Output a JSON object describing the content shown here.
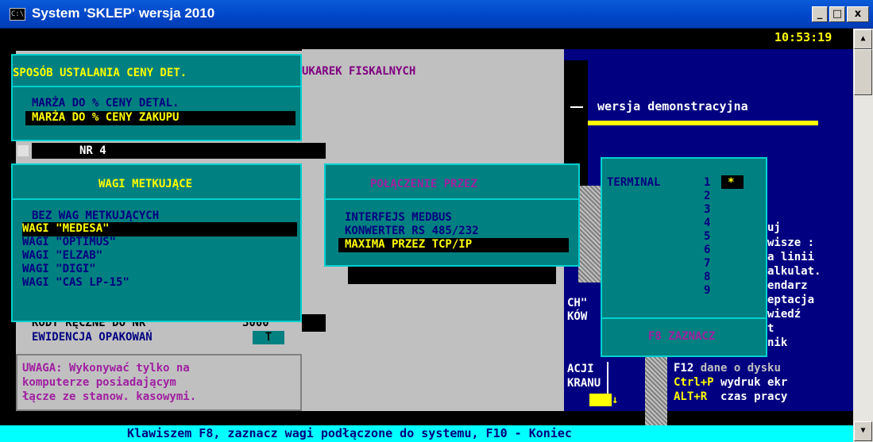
{
  "window": {
    "title": "System 'SKLEP' wersja 2010",
    "icon": "console-icon",
    "controls": {
      "minimize": "_",
      "maximize": "□",
      "close": "x"
    }
  },
  "clock": "10:53:19",
  "header_text": "UKAREK FISKALNYCH",
  "demo_text": "wersja demonstracyjna",
  "nr_label": "NR 4",
  "price_method": {
    "title": "SPOSÓB USTALANIA CENY DET.",
    "options": [
      "MARŻA DO % CENY DETAL.",
      "MARŻA DO % CENY ZAKUPU"
    ],
    "selected": 1
  },
  "scales": {
    "title": "WAGI METKUJĄCE",
    "options": [
      "BEZ WAG METKUJĄCYCH",
      "WAGI \"MEDESA\"",
      "WAGI \"OPTIMUS\"",
      "WAGI \"ELZAB\"",
      "WAGI \"DIGI\"",
      "WAGI \"CAS LP-15\""
    ],
    "selected": 1
  },
  "connection": {
    "title": "POŁĄCZENIE PRZEZ",
    "options": [
      "INTERFEJS MEDBUS",
      "KONWERTER RS 485/232",
      "MAXIMA PRZEZ TCP/IP"
    ],
    "selected": 2
  },
  "terminal": {
    "label": "TERMINAL",
    "numbers": [
      "1",
      "2",
      "3",
      "4",
      "5",
      "6",
      "7",
      "8",
      "9"
    ],
    "marker": "*",
    "footer": "F8 ZAZNACZ"
  },
  "left_panel": {
    "codes_label": "KODY RĘCZNE DO NR",
    "codes_value": "3000",
    "packaging_label": "EWIDENCJA OPAKOWAŃ",
    "packaging_value": "T",
    "warning": [
      "UWAGA: Wykonywać tylko na",
      "komputerze posiadającym",
      "łącze ze stanow. kasowymi."
    ]
  },
  "middle_fragments": {
    "line1": "CH\"",
    "line2": "KÓW",
    "line3": "ACJI",
    "line4": "KRANU"
  },
  "right_menu": {
    "items": [
      "uj",
      "wisze :",
      "a linii",
      "alkulat.",
      "endarz",
      "eptacja",
      "wiedź",
      "t",
      "nik"
    ],
    "f12_key": "F12",
    "f12_label": "dane o dysku",
    "ctrlp_key": "Ctrl+P",
    "ctrlp_label": "wydruk ekr",
    "altr_key": "ALT+R",
    "altr_label": "czas pracy"
  },
  "status_bar": "Klawiszem F8, zaznacz wagi podłączone do systemu, F10 - Koniec"
}
